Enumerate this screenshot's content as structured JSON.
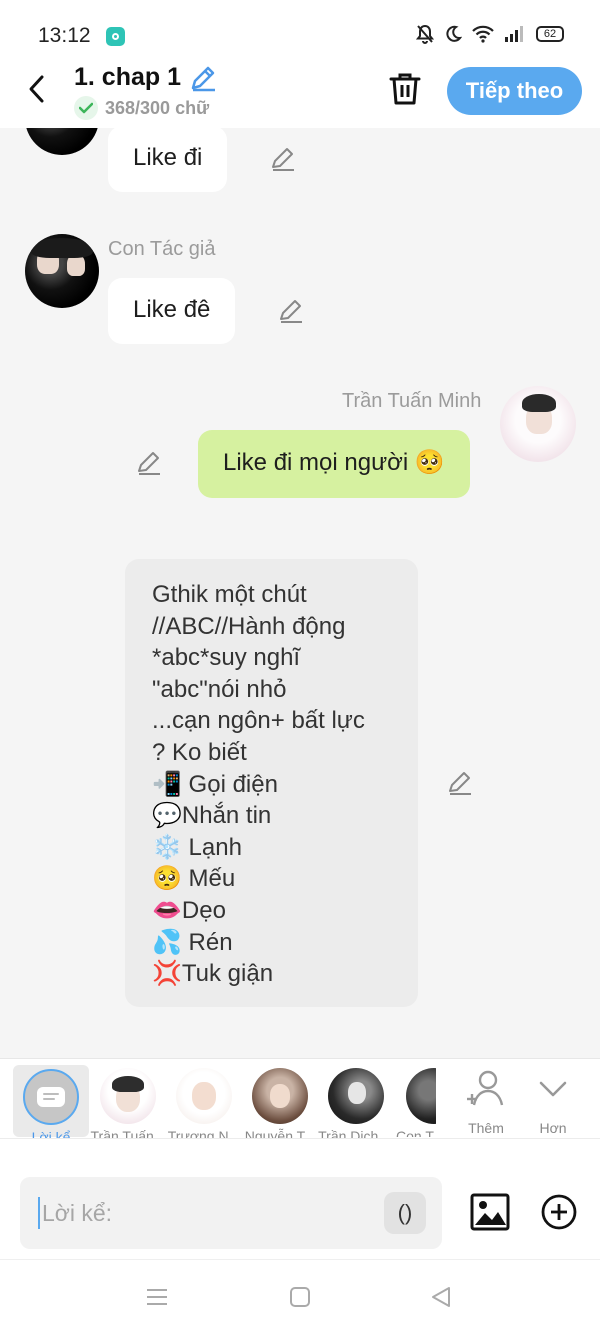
{
  "status": {
    "time": "13:12",
    "battery": "62"
  },
  "header": {
    "title": "1. chap 1",
    "word_count": "368/300 chữ",
    "next_label": "Tiếp theo"
  },
  "messages": [
    {
      "type": "left",
      "speaker": "",
      "text": "Like đi"
    },
    {
      "type": "left",
      "speaker": "Con Tác giả",
      "text": "Like đê"
    },
    {
      "type": "right",
      "speaker": "Trần Tuấn Minh",
      "text": "Like đi mọi người 🥺"
    },
    {
      "type": "narration",
      "lines": [
        "Gthik một chút",
        "//ABC//Hành động",
        "*abc*suy nghĩ",
        "\"abc\"nói nhỏ",
        "...cạn ngôn+ bất lực",
        "? Ko biết",
        "📲 Gọi điện",
        "💬Nhắn tin",
        "❄️ Lạnh",
        "🥺 Mếu",
        "👄Dẹo",
        "💦 Rén",
        "💢Tuk giận"
      ]
    }
  ],
  "characters": [
    {
      "label": "Lời kể",
      "selected": true
    },
    {
      "label": "Trần Tuấn..."
    },
    {
      "label": "Trương N..."
    },
    {
      "label": "Nguyễn T..."
    },
    {
      "label": "Trần Dịch ..."
    },
    {
      "label": "Con T"
    }
  ],
  "actions": {
    "add_label": "Thêm",
    "more_label": "Hơn"
  },
  "input": {
    "placeholder": "Lời kể:",
    "paren": "()"
  },
  "colors": {
    "accent": "#5aa9ef",
    "green_bubble": "#d6f1a0",
    "narration_bg": "#ececec"
  }
}
